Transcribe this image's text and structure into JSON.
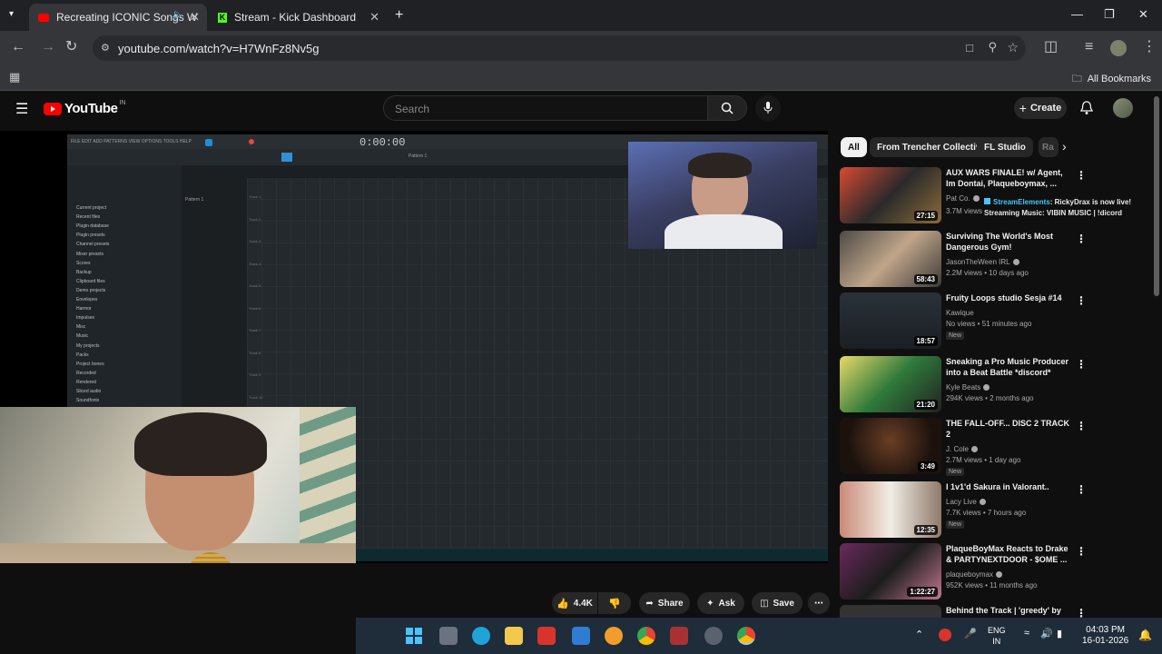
{
  "browser": {
    "tabs": [
      {
        "title": "Recreating ICONIC Songs W",
        "active": true,
        "favicon": "youtube-icon"
      },
      {
        "title": "Stream - Kick Dashboard",
        "active": false,
        "favicon": "kick-icon"
      }
    ],
    "url": "youtube.com/watch?v=H7WnFz8Nv5g",
    "all_bookmarks": "All Bookmarks"
  },
  "youtube": {
    "logo_text": "YouTube",
    "region": "IN",
    "search_placeholder": "Search",
    "create_label": "Create"
  },
  "player": {
    "daw_menu": "FILE EDIT ADD PATTERNS VIEW OPTIONS TOOLS HELP",
    "daw_time": "0:00:00",
    "browser_items": [
      "Current project",
      "Recent files",
      "Plugin database",
      "Plugin presets",
      "Channel presets",
      "Mixer presets",
      "Scores",
      "Backup",
      "Clipboard files",
      "Demo projects",
      "Envelopes",
      "Harmor",
      "Impulses",
      "Misc",
      "Music",
      "My projects",
      "Packs",
      "Project bones",
      "Recorded",
      "Rendered",
      "Sliced audio",
      "Soundfonts"
    ],
    "tracks": [
      "Track 1",
      "Track 2",
      "Track 3",
      "Track 4",
      "Track 5",
      "Track 6",
      "Track 7",
      "Track 8",
      "Track 9",
      "Track 10"
    ],
    "pattern_label": "Pattern 1"
  },
  "actions": {
    "likes": "4.4K",
    "share": "Share",
    "ask": "Ask",
    "save": "Save"
  },
  "chips": [
    "All",
    "From Trencher Collective",
    "FL Studio",
    "Ra"
  ],
  "videos": [
    {
      "title": "AUX WARS FINALE! w/ Agent, Im Dontai, Plaqueboymax, ...",
      "channel": "Pat Co.",
      "meta": "3.7M views",
      "duration": "27:15",
      "new": ""
    },
    {
      "title": "Surviving The World's Most Dangerous Gym!",
      "channel": "JasonTheWeen IRL",
      "meta": "2.2M views • 10 days ago",
      "duration": "58:43",
      "new": ""
    },
    {
      "title": "Fruity Loops studio Sesja #14",
      "channel": "Kawique",
      "meta": "No views • 51 minutes ago",
      "duration": "18:57",
      "new": "New"
    },
    {
      "title": "Sneaking a Pro Music Producer into a Beat Battle *discord*",
      "channel": "Kyle Beats",
      "meta": "294K views • 2 months ago",
      "duration": "21:20",
      "new": ""
    },
    {
      "title": "THE FALL-OFF... DISC 2 TRACK 2",
      "channel": "J. Cole",
      "meta": "2.7M views • 1 day ago",
      "duration": "3:49",
      "new": "New"
    },
    {
      "title": "I 1v1'd Sakura in Valorant..",
      "channel": "Lacy Live",
      "meta": "7.7K views • 7 hours ago",
      "duration": "12:35",
      "new": "New"
    },
    {
      "title": "PlaqueBoyMax Reacts to Drake & PARTYNEXTDOOR - $OME ...",
      "channel": "plaqueboymax",
      "meta": "952K views • 11 months ago",
      "duration": "1:22:27",
      "new": ""
    },
    {
      "title": "Behind the Track | 'greedy' by",
      "channel": "",
      "meta": "",
      "duration": "",
      "new": ""
    }
  ],
  "stream_overlay": {
    "name": "StreamElements",
    "line1": ": RickyDrax is now live!",
    "line2": "Streaming Music: VIBIN MUSIC | !dicord"
  },
  "system": {
    "lang1": "ENG",
    "lang2": "IN",
    "time": "04:03 PM",
    "date": "16-01-2026"
  }
}
